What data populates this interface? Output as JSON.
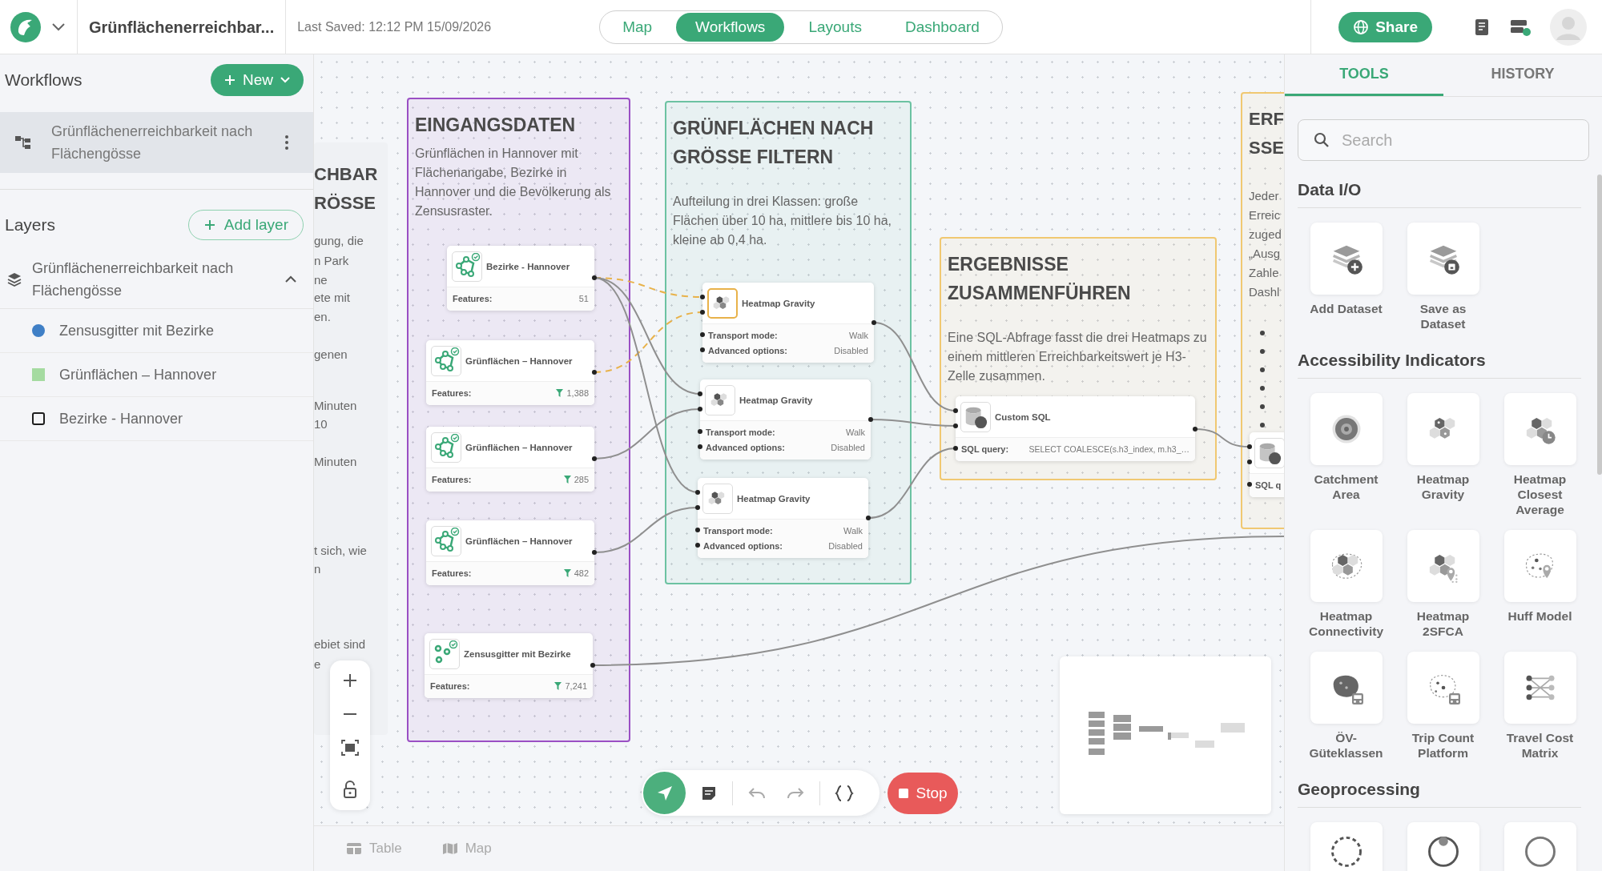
{
  "app": {
    "title": "Grünflächenerreichbar...",
    "last_saved": "Last Saved: 12:12 PM 15/09/2026"
  },
  "nav_tabs": [
    {
      "label": "Map",
      "selected": false
    },
    {
      "label": "Workflows",
      "selected": true
    },
    {
      "label": "Layouts",
      "selected": false
    },
    {
      "label": "Dashboard",
      "selected": false
    }
  ],
  "share_button": "Share",
  "sidebar": {
    "workflows_title": "Workflows",
    "new_button": "New",
    "workflows": [
      {
        "name": "Grünflächenerreichbarkeit nach Flächengösse",
        "selected": true
      }
    ],
    "layers_title": "Layers",
    "add_layer_button": "Add layer",
    "layer_group": {
      "name": "Grünflächenerreichbarkeit nach Flächengösse",
      "expanded": true,
      "layers": [
        {
          "name": "Zensusgitter mit Bezirke",
          "kind": "point",
          "color": "#3f7fc6"
        },
        {
          "name": "Grünflächen – Hannover",
          "kind": "polygon",
          "color": "#a5dba1"
        },
        {
          "name": "Bezirke - Hannover",
          "kind": "outline",
          "color": "#1e1e1e"
        }
      ]
    }
  },
  "canvas": {
    "groups": [
      {
        "kind": "partial",
        "title_lines": [
          "CHBAR",
          "RÖSSE"
        ],
        "lines": [
          "gung, die",
          "n Park",
          "ne",
          "ete mit",
          "en.",
          "genen",
          "Minuten",
          "10",
          "Minuten",
          "t sich, wie",
          "n",
          "ebiet sind",
          "e"
        ]
      },
      {
        "kind": "group",
        "color": "#9a4fc4",
        "title": "EINGANGSDATEN",
        "text": "Grünflächen in Hannover mit Flächenangabe, Bezirke in Hannover und die Bevölkerung als Zensusraster."
      },
      {
        "kind": "group",
        "color": "#6cc2a2",
        "title": "GRÜNFLÄCHEN NACH GRÖSSE FILTERN",
        "text": "Aufteilung in drei Klassen: große Flächen über 10 ha, mittlere bis 10 ha, kleine ab 0,4 ha."
      },
      {
        "kind": "group",
        "color": "#f0c871",
        "title": "ERGEBNISSE ZUSAMMENFÜHREN",
        "text": "Eine SQL-Abfrage fasst die drei Heatmaps zu einem mittleren Erreichbarkeitswert je H3-Zelle zusammen."
      },
      {
        "kind": "partial",
        "color": "#f0c871",
        "title_lines": [
          "ERF",
          "SSE"
        ],
        "lines": [
          "Jeder",
          "Erreic",
          "zuged",
          "„Ausg",
          "Zahle",
          "Dashl"
        ],
        "bullets": [
          {
            "kind": "bullet"
          },
          {
            "kind": "bullet"
          },
          {
            "kind": "bullet"
          },
          {
            "kind": "bullet"
          },
          {
            "kind": "bullet"
          },
          {
            "kind": "bullet"
          }
        ]
      }
    ],
    "nodes": [
      {
        "kind": "polygon",
        "title": "Bezirke - Hannover",
        "highlighted": false,
        "rows": [
          {
            "label": "Features:",
            "value": "51",
            "filtered": false
          }
        ]
      },
      {
        "kind": "polygon",
        "title": "Grünflächen – Hannover",
        "highlighted": false,
        "rows": [
          {
            "label": "Features:",
            "value": "1,388",
            "filtered": true
          }
        ]
      },
      {
        "kind": "polygon",
        "title": "Grünflächen – Hannover",
        "highlighted": false,
        "rows": [
          {
            "label": "Features:",
            "value": "285",
            "filtered": true
          }
        ]
      },
      {
        "kind": "polygon",
        "title": "Grünflächen – Hannover",
        "highlighted": false,
        "rows": [
          {
            "label": "Features:",
            "value": "482",
            "filtered": true
          }
        ]
      },
      {
        "kind": "points",
        "title": "Zensusgitter mit Bezirke",
        "highlighted": false,
        "rows": [
          {
            "label": "Features:",
            "value": "7,241",
            "filtered": true
          }
        ]
      },
      {
        "kind": "heatmap",
        "title": "Heatmap Gravity",
        "highlighted": true,
        "rows": [
          {
            "label": "Transport mode:",
            "value": "Walk"
          },
          {
            "label": "Advanced options:",
            "value": "Disabled"
          }
        ]
      },
      {
        "kind": "heatmap",
        "title": "Heatmap Gravity",
        "highlighted": false,
        "rows": [
          {
            "label": "Transport mode:",
            "value": "Walk"
          },
          {
            "label": "Advanced options:",
            "value": "Disabled"
          }
        ]
      },
      {
        "kind": "heatmap",
        "title": "Heatmap Gravity",
        "highlighted": false,
        "rows": [
          {
            "label": "Transport mode:",
            "value": "Walk"
          },
          {
            "label": "Advanced options:",
            "value": "Disabled"
          }
        ]
      },
      {
        "kind": "sql",
        "title": "Custom SQL",
        "highlighted": false,
        "rows": [
          {
            "label": "SQL query:",
            "value": "SELECT COALESCE(s.h3_index, m.h3_…"
          }
        ]
      },
      {
        "kind": "sql",
        "highlighted": false,
        "rows": [
          {
            "label": "SQL q"
          }
        ]
      }
    ]
  },
  "toolbar": {
    "stop_button": "Stop"
  },
  "bottom_tabs": [
    {
      "label": "Table"
    },
    {
      "label": "Map"
    }
  ],
  "tools_panel": {
    "tabs": [
      {
        "label": "TOOLS",
        "selected": true
      },
      {
        "label": "HISTORY",
        "selected": false
      }
    ],
    "search": {
      "placeholder": "Search"
    },
    "sections": [
      {
        "title": "Data I/O",
        "tools": [
          {
            "kind": "tool",
            "label": "Add Dataset"
          },
          {
            "kind": "tool",
            "label": "Save as Dataset"
          }
        ]
      },
      {
        "title": "Accessibility Indicators",
        "tools": [
          {
            "kind": "tool",
            "label": "Catchment Area"
          },
          {
            "kind": "tool",
            "label": "Heatmap Gravity"
          },
          {
            "kind": "tool",
            "label": "Heatmap Closest Average"
          },
          {
            "kind": "tool",
            "label": "Heatmap Connectivity"
          },
          {
            "kind": "tool",
            "label": "Heatmap 2SFCA"
          },
          {
            "kind": "tool",
            "label": "Huff Model"
          },
          {
            "kind": "tool",
            "label": "ÖV-Güteklassen"
          },
          {
            "kind": "tool",
            "label": "Trip Count Platform"
          },
          {
            "kind": "tool",
            "label": "Travel Cost Matrix"
          }
        ]
      },
      {
        "title": "Geoprocessing",
        "tools": [
          {
            "kind": "tool"
          },
          {
            "kind": "tool"
          },
          {
            "kind": "tool"
          }
        ]
      }
    ]
  }
}
